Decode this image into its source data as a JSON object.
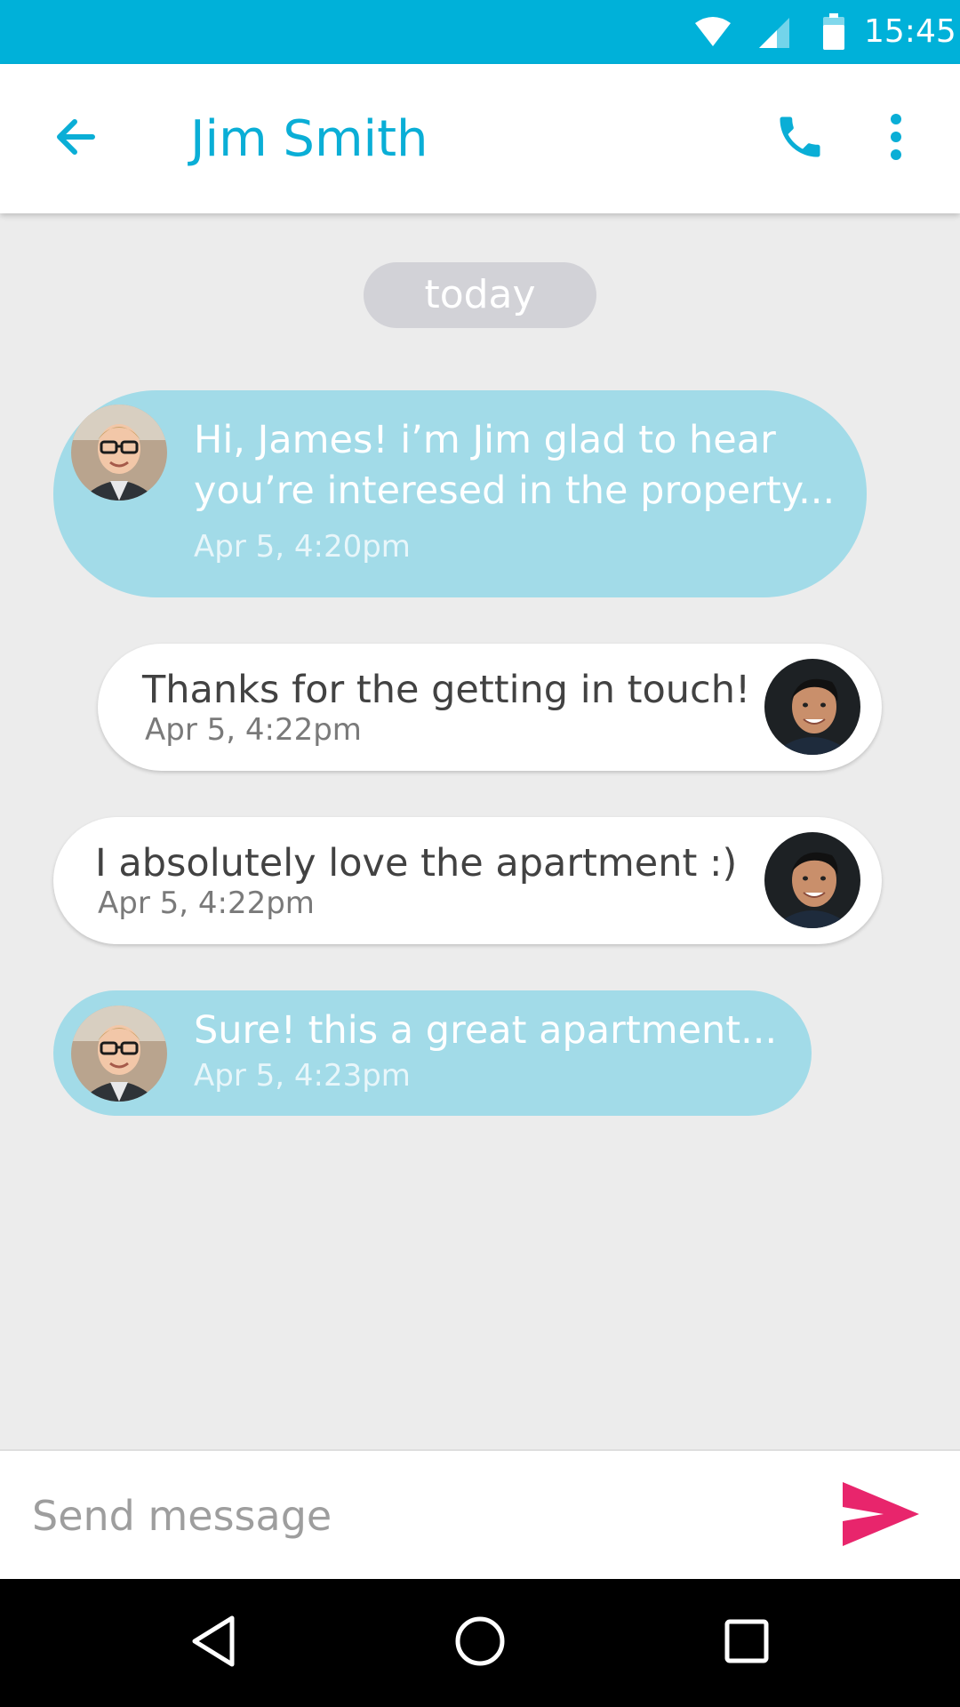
{
  "status_bar": {
    "time": "15:45",
    "icons": [
      "wifi-icon",
      "cell-signal-icon",
      "battery-icon"
    ]
  },
  "app_bar": {
    "title": "Jim Smith",
    "icons": [
      "back-arrow-icon",
      "phone-icon",
      "more-vertical-icon"
    ],
    "accent_color": "#0aaed6"
  },
  "conversation": {
    "date_label": "today",
    "messages": [
      {
        "sender": "Jim Smith",
        "direction": "incoming",
        "lines": [
          "Hi, James! i’m Jim glad to hear",
          "you’re interesed in the property..."
        ],
        "time": "Apr 5, 4:20pm"
      },
      {
        "sender": "James",
        "direction": "outgoing",
        "lines": [
          "Thanks for the getting in touch!"
        ],
        "time": "Apr 5, 4:22pm"
      },
      {
        "sender": "James",
        "direction": "outgoing",
        "lines": [
          "I absolutely love the apartment  :)"
        ],
        "time": "Apr 5, 4:22pm"
      },
      {
        "sender": "Jim Smith",
        "direction": "incoming",
        "lines": [
          "Sure! this a great apartment..."
        ],
        "time": "Apr 5, 4:23pm"
      }
    ],
    "colors": {
      "incoming_bubble": "#a2dbe8",
      "outgoing_bubble": "#ffffff",
      "background": "#ececec"
    }
  },
  "composer": {
    "placeholder": "Send message",
    "value": "",
    "send_icon": "send-icon",
    "send_color": "#e8256c"
  },
  "nav_bar": {
    "icons": [
      "nav-back-icon",
      "nav-home-icon",
      "nav-recents-icon"
    ]
  }
}
